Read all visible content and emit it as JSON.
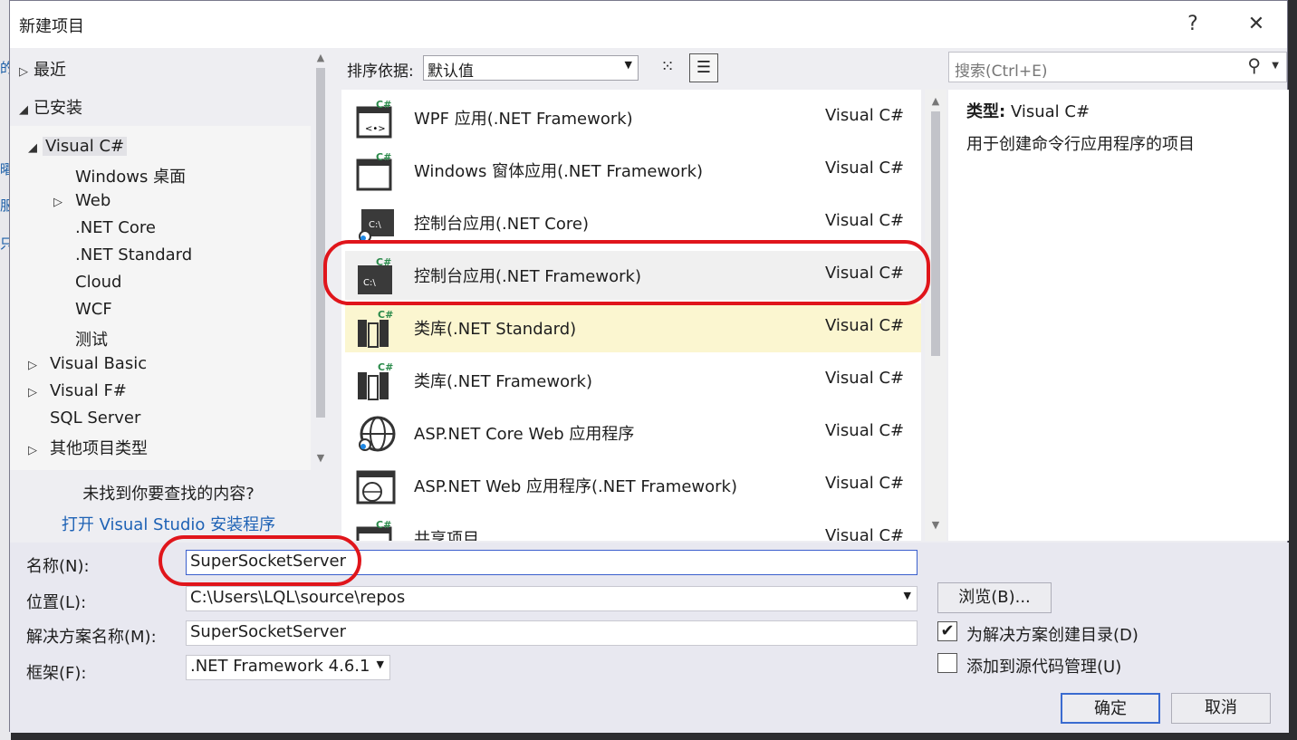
{
  "dialog": {
    "title": "新建项目",
    "help": "?",
    "close": "✕"
  },
  "tree": {
    "recent": "最近",
    "installed": "已安装",
    "items": [
      {
        "label": "Visual C#",
        "arrow": "◢"
      },
      {
        "label": "Windows 桌面",
        "arrow": ""
      },
      {
        "label": "Web",
        "arrow": "▷"
      },
      {
        "label": ".NET Core",
        "arrow": ""
      },
      {
        "label": ".NET Standard",
        "arrow": ""
      },
      {
        "label": "Cloud",
        "arrow": ""
      },
      {
        "label": "WCF",
        "arrow": ""
      },
      {
        "label": "测试",
        "arrow": ""
      },
      {
        "label": "Visual Basic",
        "arrow": "▷"
      },
      {
        "label": "Visual F#",
        "arrow": "▷"
      },
      {
        "label": "SQL Server",
        "arrow": ""
      },
      {
        "label": "其他项目类型",
        "arrow": "▷"
      }
    ],
    "not_found": "未找到你要查找的内容?",
    "open_installer": "打开 Visual Studio 安装程序"
  },
  "sort": {
    "label": "排序依据:",
    "value": "默认值"
  },
  "search": {
    "placeholder": "搜索(Ctrl+E)"
  },
  "templates": [
    {
      "name": "WPF 应用(.NET Framework)",
      "lang": "Visual C#",
      "icon": "wpf-app-icon"
    },
    {
      "name": "Windows 窗体应用(.NET Framework)",
      "lang": "Visual C#",
      "icon": "winforms-app-icon"
    },
    {
      "name": "控制台应用(.NET Core)",
      "lang": "Visual C#",
      "icon": "console-core-icon"
    },
    {
      "name": "控制台应用(.NET Framework)",
      "lang": "Visual C#",
      "icon": "console-framework-icon"
    },
    {
      "name": "类库(.NET Standard)",
      "lang": "Visual C#",
      "icon": "class-library-icon"
    },
    {
      "name": "类库(.NET Framework)",
      "lang": "Visual C#",
      "icon": "class-library-icon"
    },
    {
      "name": "ASP.NET Core Web 应用程序",
      "lang": "Visual C#",
      "icon": "globe-icon"
    },
    {
      "name": "ASP.NET Web 应用程序(.NET Framework)",
      "lang": "Visual C#",
      "icon": "web-globe-icon"
    },
    {
      "name": "共享项目",
      "lang": "Visual C#",
      "icon": "shared-project-icon"
    }
  ],
  "details": {
    "type_label": "类型:",
    "type_value": "Visual C#",
    "description": "用于创建命令行应用程序的项目"
  },
  "form": {
    "name_label": "名称(N):",
    "name_value": "SuperSocketServer",
    "location_label": "位置(L):",
    "location_value": "C:\\Users\\LQL\\source\\repos",
    "solution_label": "解决方案名称(M):",
    "solution_value": "SuperSocketServer",
    "framework_label": "框架(F):",
    "framework_value": ".NET Framework 4.6.1",
    "browse": "浏览(B)...",
    "create_dir": "为解决方案创建目录(D)",
    "create_dir_checked": true,
    "add_source_control": "添加到源代码管理(U)",
    "add_source_control_checked": false,
    "ok": "确定",
    "cancel": "取消"
  },
  "colors": {
    "accent": "#3a6bd0",
    "highlight": "#e0151b",
    "selected_row": "#fbf6d0",
    "link": "#1e62b5"
  }
}
